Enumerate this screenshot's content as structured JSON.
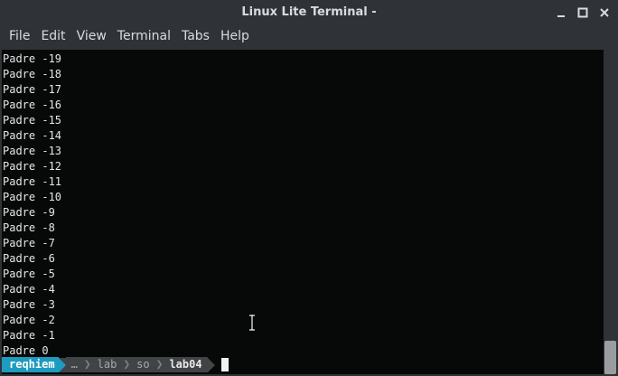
{
  "window": {
    "title": "Linux Lite Terminal -"
  },
  "menu": {
    "items": [
      "File",
      "Edit",
      "View",
      "Terminal",
      "Tabs",
      "Help"
    ]
  },
  "terminal": {
    "lines": [
      "Padre -19",
      "Padre -18",
      "Padre -17",
      "Padre -16",
      "Padre -15",
      "Padre -14",
      "Padre -13",
      "Padre -12",
      "Padre -11",
      "Padre -10",
      "Padre -9",
      "Padre -8",
      "Padre -7",
      "Padre -6",
      "Padre -5",
      "Padre -4",
      "Padre -3",
      "Padre -2",
      "Padre -1",
      "Padre 0"
    ],
    "prompt": {
      "user": "reqhiem",
      "ellipsis": "…",
      "path_parts": [
        "lab",
        "so"
      ],
      "current_dir": "lab04"
    }
  },
  "colors": {
    "terminal_bg": "#060908",
    "user_segment": "#1e9bbf",
    "path_segment": "#404447",
    "chrome": "#2f3338"
  },
  "icons": {
    "minimize": "minimize-icon",
    "maximize": "maximize-icon",
    "close": "close-icon",
    "text_cursor": "ibeam-cursor-icon"
  }
}
